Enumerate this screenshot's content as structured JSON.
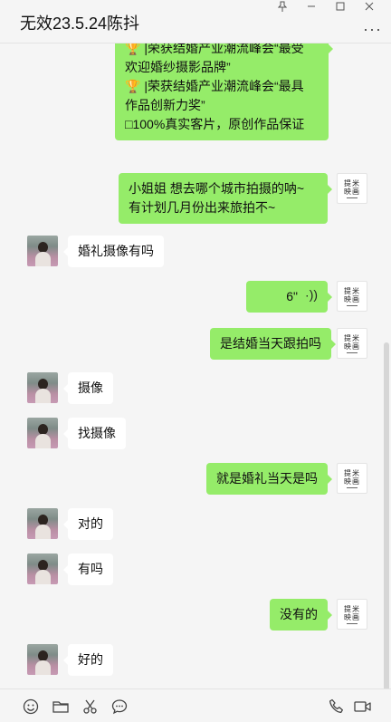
{
  "window": {
    "title": "无效23.5.24陈抖",
    "more_label": "···"
  },
  "messages": [
    {
      "side": "out",
      "text": "🏆 |荣获结婚产业潮流峰会“最受\n欢迎婚纱摄影品牌”\n🏆 |荣获结婚产业潮流峰会“最具\n作品创新力奖”\n□100%真实客片，原创作品保证"
    },
    {
      "side": "out",
      "text": "小姐姐  想去哪个城市拍摄的呐~\n有计划几月份出来旅拍不~"
    },
    {
      "side": "in",
      "text": "婚礼摄像有吗"
    },
    {
      "side": "out",
      "voice": true,
      "text": "6\""
    },
    {
      "side": "out",
      "text": "是结婚当天跟拍吗"
    },
    {
      "side": "in",
      "text": "摄像"
    },
    {
      "side": "in",
      "text": "找摄像"
    },
    {
      "side": "out",
      "text": "就是婚礼当天是吗"
    },
    {
      "side": "in",
      "text": "对的"
    },
    {
      "side": "in",
      "text": "有吗"
    },
    {
      "side": "out",
      "text": "没有的"
    },
    {
      "side": "in",
      "text": "好的"
    }
  ],
  "brand_avatar": {
    "line1": "提米",
    "line2": "映画"
  },
  "toolbar": {
    "emoji": "emoji-icon",
    "folder": "folder-icon",
    "scissors": "scissors-icon",
    "chat": "chat-bubble-icon",
    "phone": "phone-icon",
    "video": "video-call-icon"
  },
  "colors": {
    "outgoing": "#95ec69",
    "incoming": "#ffffff",
    "background": "#f5f5f5"
  }
}
